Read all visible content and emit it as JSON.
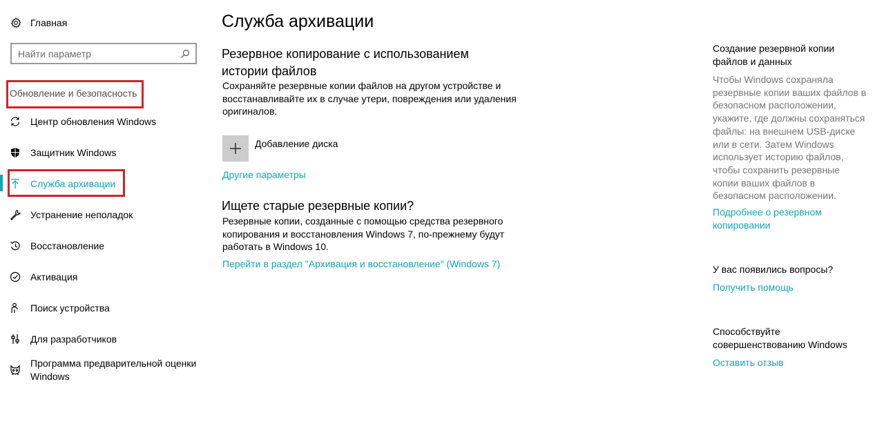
{
  "sidebar": {
    "home_label": "Главная",
    "search_placeholder": "Найти параметр",
    "section_title": "Обновление и безопасность",
    "items": [
      {
        "label": "Центр обновления Windows",
        "icon": "sync-icon"
      },
      {
        "label": "Защитник Windows",
        "icon": "shield-icon"
      },
      {
        "label": "Служба архивации",
        "icon": "backup-arrow-icon",
        "active": true
      },
      {
        "label": "Устранение неполадок",
        "icon": "wrench-icon"
      },
      {
        "label": "Восстановление",
        "icon": "history-icon"
      },
      {
        "label": "Активация",
        "icon": "check-circle-icon"
      },
      {
        "label": "Поиск устройства",
        "icon": "person-pin-icon"
      },
      {
        "label": "Для разработчиков",
        "icon": "developer-sliders-icon"
      },
      {
        "label": "Программа предварительной оценки Windows",
        "icon": "insider-cat-icon"
      }
    ]
  },
  "main": {
    "title": "Служба архивации",
    "file_history": {
      "heading": "Резервное копирование с использованием истории файлов",
      "description": "Сохраняйте резервные копии файлов на другом устройстве и восстанавливайте их в случае утери, повреждения или удаления оригиналов.",
      "add_drive_label": "Добавление диска",
      "more_options_link": "Другие параметры"
    },
    "old_backups": {
      "heading": "Ищете старые резервные копии?",
      "description": "Резервные копии, созданные с помощью средства резервного копирования и восстановления Windows 7, по-прежнему будут работать в Windows 10.",
      "link": "Перейти в раздел \"Архивация и восстановление\" (Windows 7)"
    }
  },
  "right": {
    "backup_heading": "Создание резервной копии файлов и данных",
    "backup_desc": "Чтобы Windows сохраняла резервные копии ваших файлов в безопасном расположении, укажите, где должны сохраняться файлы: на внешнем USB-диске или в сети. Затем Windows использует историю файлов, чтобы сохранить резервные копии ваших файлов в безопасном расположении.",
    "backup_link": "Подробнее о резервном копировании",
    "questions_heading": "У вас появились вопросы?",
    "help_link": "Получить помощь",
    "improve_heading": "Способствуйте совершенствованию Windows",
    "feedback_link": "Оставить отзыв"
  },
  "colors": {
    "accent": "#12a6b4",
    "highlight_box": "#d0242b",
    "secondary_text": "#767676"
  }
}
